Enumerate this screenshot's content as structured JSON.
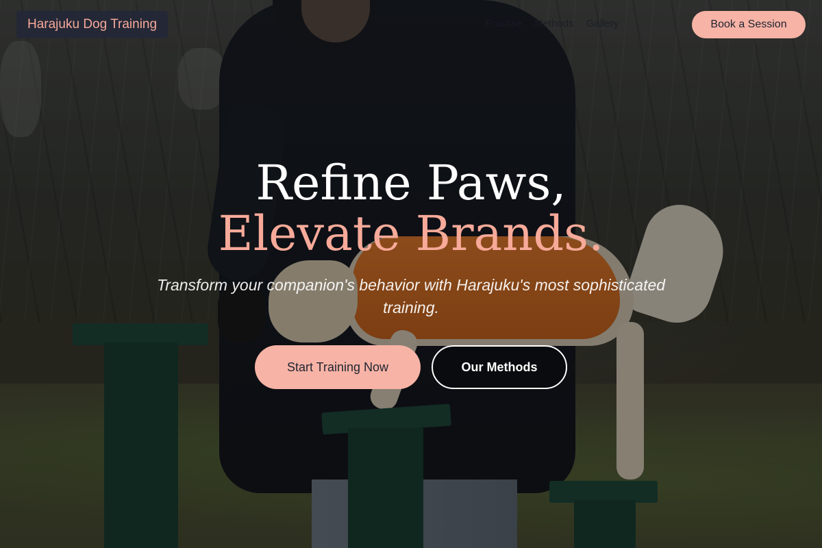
{
  "brand": {
    "name": "Harajuku Dog Training"
  },
  "nav": {
    "items": [
      {
        "label": "Practise"
      },
      {
        "label": "Methods"
      },
      {
        "label": "Gallery"
      }
    ],
    "cta_label": "Book a Session"
  },
  "hero": {
    "headline_line1": "Refine Paws,",
    "headline_line2": "Elevate Brands.",
    "subtitle": "Transform your companion's behavior with Harajuku's most sophisticated training.",
    "primary_cta": "Start Training Now",
    "secondary_cta": "Our Methods"
  },
  "colors": {
    "accent": "#f7b3a6",
    "headline_accent": "#f7aa99",
    "brand_bg": "#232837"
  }
}
